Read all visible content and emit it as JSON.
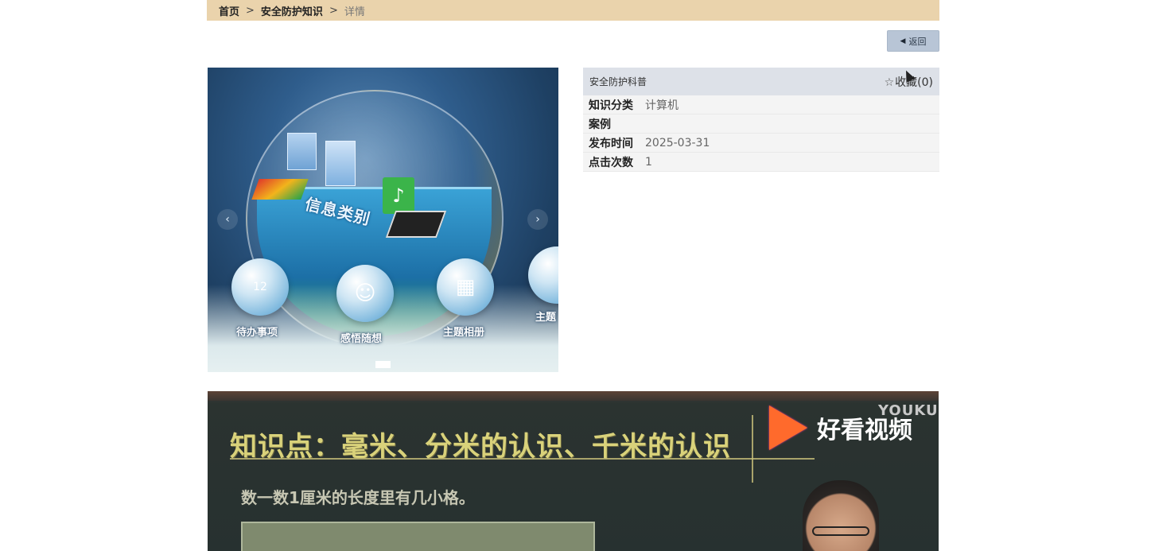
{
  "breadcrumb": {
    "home": "首页",
    "separator": ">",
    "section": "安全防护知识",
    "current": "详情"
  },
  "back_button": {
    "icon": "caret-left-icon",
    "label": "返回"
  },
  "carousel": {
    "center_label": "信息类别",
    "items": [
      {
        "label": "待办事项",
        "icon": "calendar-icon",
        "date": "12"
      },
      {
        "label": "感悟随想",
        "icon": "user-sparkle-icon"
      },
      {
        "label": "主题相册",
        "icon": "picture-icon"
      },
      {
        "label": "主题",
        "icon": "partial-icon"
      }
    ],
    "prev_icon": "chevron-left-icon",
    "next_icon": "chevron-right-icon"
  },
  "info": {
    "category_title": "安全防护科普",
    "favorite": {
      "icon": "star-outline-icon",
      "label": "收藏(0)"
    },
    "rows": [
      {
        "key": "知识分类",
        "value": "计算机"
      },
      {
        "key": "案例",
        "value": ""
      },
      {
        "key": "发布时间",
        "value": "2025-03-31"
      },
      {
        "key": "点击次数",
        "value": "1"
      }
    ]
  },
  "video": {
    "title": "知识点：毫米、分米的认识、千米的认识",
    "subtitle": "数一数1厘米的长度里有几小格。",
    "brand": "好看视频",
    "watermark": "YOUKU"
  },
  "colors": {
    "breadcrumb_bg": "#ead3ac",
    "back_button_bg": "#b8c5d6",
    "info_head_bg": "#dde1e8",
    "info_row_bg": "#f4f4f4"
  }
}
